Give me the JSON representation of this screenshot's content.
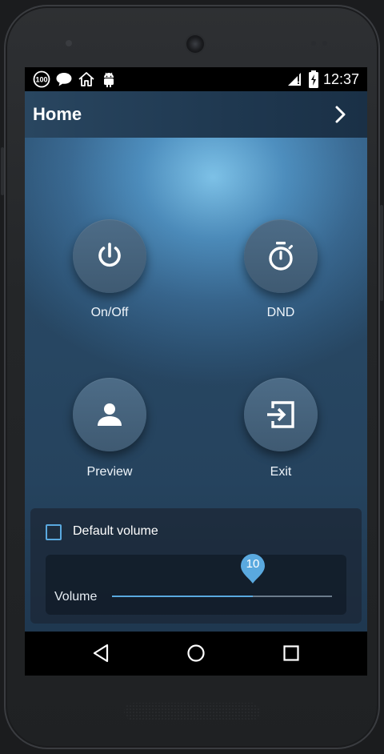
{
  "status_bar": {
    "time": "12:37",
    "notification_icons": [
      "hundred-icon",
      "chat-bubble-icon",
      "home-outline-icon",
      "android-icon"
    ],
    "system_icons": [
      "signal-icon",
      "battery-charging-icon"
    ]
  },
  "app_bar": {
    "title": "Home",
    "action_icon": "chevron-right-icon"
  },
  "actions": [
    {
      "label": "On/Off",
      "icon": "power-icon"
    },
    {
      "label": "DND",
      "icon": "stopwatch-icon"
    },
    {
      "label": "Preview",
      "icon": "person-icon"
    },
    {
      "label": "Exit",
      "icon": "exit-icon"
    }
  ],
  "settings": {
    "default_volume_label": "Default volume",
    "default_volume_checked": false,
    "volume_label": "Volume",
    "volume_value": "10",
    "volume_fraction": 0.64
  },
  "nav_bar": {
    "buttons": [
      "back-icon",
      "home-icon",
      "recents-icon"
    ]
  },
  "colors": {
    "accent": "#5aa9df",
    "app_bar": "#294660",
    "button": "#4d6c87"
  }
}
